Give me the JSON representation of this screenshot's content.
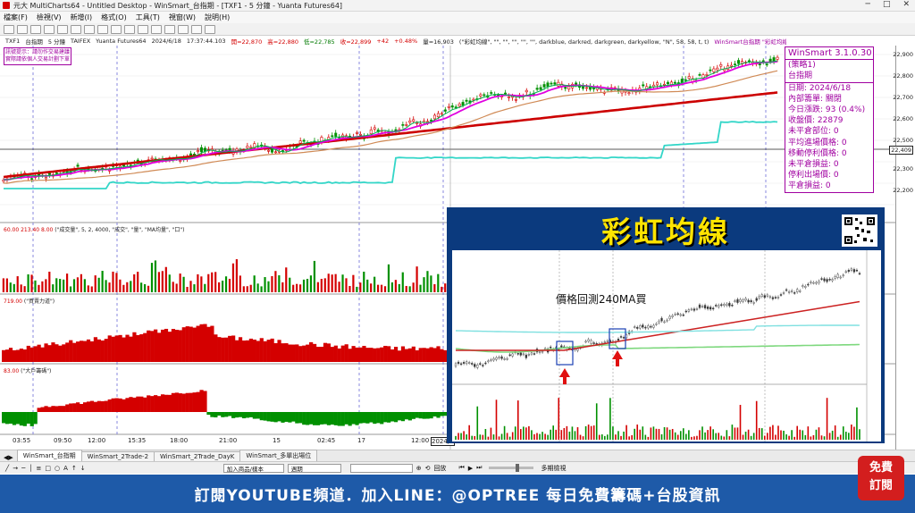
{
  "window": {
    "title": "元大 MultiCharts64 - Untitled Desktop - WinSmart_台指期 - [TXF1 - 5 分鐘 - Yuanta Futures64]",
    "controls": [
      "─",
      "□",
      "✕"
    ]
  },
  "menu": [
    "檔案(F)",
    "檢視(V)",
    "新增(I)",
    "格式(O)",
    "工具(T)",
    "視窗(W)",
    "說明(H)"
  ],
  "chart_header": {
    "symbol": "TXF1",
    "name": "台指期",
    "interval": "5 分鐘",
    "exchange": "TAIFEX",
    "feed": "Yuanta Futures64",
    "date": "2024/6/18",
    "time": "17:37:44.103",
    "open": "開=22,870",
    "high": "高=22,880",
    "low": "低=22,785",
    "close": "收=22,899",
    "change": "+42",
    "change_pct": "+0.48%",
    "volume": "量=16,903",
    "indicator": "(\"彩虹均線\", \"\", \"\", \"\", \"\", \"\", darkblue, darkred, darkgreen, darkyellow, \"N\", 58, 58, t, t)",
    "right_label": "WinSmart台指期 \"彩虹均線\" 22.8K"
  },
  "annotation_box": [
    "訊號提示：請勿作交易建議",
    "實際請依個人交易計劃下單"
  ],
  "price_axis": [
    "22,900",
    "22,800",
    "22,700",
    "22,600",
    "22,500",
    "22,409",
    "22,300",
    "22,200"
  ],
  "price_tag_right": "22,409",
  "info_box": {
    "title": "WinSmart 3.1.0.30",
    "lines": [
      "(策略1)",
      "台指期",
      "日期: 2024/6/18",
      "內部籌單: 關閉",
      "今日漲跌: 93 (0.4%)",
      "收盤價: 22879",
      "未平倉部位: 0",
      "平均進場價格: 0",
      "移動停利價格: 0",
      "未平倉損益: 0",
      "停利出場價: 0",
      "平倉損益: 0"
    ]
  },
  "panes": [
    {
      "label": "(\"成交量\", 5, 2, 4000, \"成交\", \"量\", \"MA均量\", \"口\")",
      "value_tag": "60.00  213.40  8.00"
    },
    {
      "label": "(\"買賣力道\")",
      "value_tag": "719.00"
    },
    {
      "label": "(\"大戶籌碼\")",
      "value_tag": "83.00"
    }
  ],
  "time_axis": [
    "03:55",
    "09:50",
    "12:00",
    "15:35",
    "18:00",
    "21:00",
    "15",
    "02:45",
    "17",
    "12:00",
    "2024/6"
  ],
  "overlay": {
    "title": "彩虹均線",
    "annotation": "價格回測240MA買"
  },
  "tabs": [
    "WinSmart_台指期",
    "WinSmart_2Trade-2",
    "WinSmart_2Trade_DayK",
    "WinSmart_多單出場位"
  ],
  "bottom_bar": {
    "symbol_select": "加入商品/樣本",
    "interval_select": "週期",
    "play_label": "回放",
    "zoom_label": "多期檢視"
  },
  "banner": {
    "text": "訂閱YOUTUBE頻道．加入LINE：@OPTREE 每日免費籌碼+台股資訊"
  },
  "subscribe_badge": [
    "免費",
    "訂閱"
  ],
  "colors": {
    "up": "#d40000",
    "down": "#009000",
    "ma_magenta": "#e000e0",
    "ma_red": "#cc0000",
    "ma_cyan": "#33d6c8",
    "banner": "#1e5aa8",
    "overlay_bg": "#0b3a7e",
    "overlay_title": "#ffe400"
  }
}
